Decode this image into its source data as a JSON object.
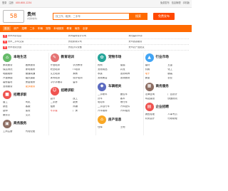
{
  "topbar": {
    "left": [
      "登录",
      "注册"
    ],
    "phone": "400-600-1234",
    "right": [
      "免费发布",
      "信息管理",
      "手机版"
    ]
  },
  "header": {
    "logo": "58",
    "city": "贵州",
    "switch": "[切换城市]",
    "search_placeholder": "找工作、租房、二手车",
    "search_button": "搜索",
    "post_button": "免费发布"
  },
  "nav": [
    "首页",
    "房产",
    "招聘",
    "二手",
    "车辆",
    "宠物",
    "本地服务",
    "教育",
    "商务",
    "全部"
  ],
  "ads": [
    [
      "贵州商务信息",
      "贵州装修设计公司",
      "贵阳建材市场"
    ],
    [
      "贵州二手车交易",
      "贵阳家政公司",
      "贵州旅游服务"
    ],
    [
      "贵州物流货运",
      "贵阳办公设备",
      "贵州农产品批发"
    ]
  ],
  "sections": {
    "local": {
      "title": "本地生活",
      "items": [
        "家政服务",
        "搬家服务",
        "保洁清洗",
        "家电维修",
        "电脑维修",
        "管道疏通",
        "开锁换锁",
        "婚庆摄影",
        "装修建材",
        "房屋维修",
        "宠物服务",
        "更多服务"
      ]
    },
    "edu": {
      "title": "教育培训",
      "items": [
        "外语培训",
        "学历教育",
        "职业培训",
        "IT培训",
        "文艺培训",
        "家教",
        "体育培训",
        "设计培训",
        "中小学辅导",
        "留学"
      ]
    },
    "recruit": {
      "title": "招聘求职",
      "items": [
        "普工",
        "司机",
        "销售",
        "客服",
        "厨师",
        "保安",
        "服务员",
        "文员",
        "会计",
        "技工"
      ]
    },
    "pet": {
      "title": "宠物市场",
      "items": [
        "狗狗",
        "猫猫",
        "宠物用品",
        "异宠",
        "水族",
        "宠物寄养",
        "宠物美容",
        "宠物医院"
      ]
    },
    "car": {
      "title": "车辆相关",
      "items": [
        "二手轿车",
        "面包车",
        "货车",
        "客车",
        "电动车",
        "摩托车",
        "二手自行车",
        "汽车配件",
        "汽车维修",
        "汽车租赁"
      ]
    },
    "house": {
      "title": "房产信息",
      "items": [
        "二手房",
        "新房",
        "租房",
        "商铺",
        "写字楼",
        "厂房",
        "仓库",
        "土地"
      ]
    },
    "business": {
      "title": "商务服务",
      "items": [
        "工商注册",
        "代理记账",
        "法律咨询",
        "广告设计",
        "网站建设",
        "快递物流"
      ]
    },
    "industry": {
      "title": "行业市场",
      "items": [
        "建材",
        "五金",
        "机械",
        "化工",
        "电子",
        "服装",
        "食品",
        "农业"
      ]
    },
    "corp": {
      "title": "企业招聘",
      "items": [
        "销售经理",
        "人事专员",
        "财务会计",
        "行政助理"
      ]
    }
  },
  "colors": {
    "accent": "#ff6a00",
    "edu": "#e57373",
    "recruit": "#ef5350",
    "pet": "#26a69a",
    "car": "#5c6bc0",
    "house": "#f9a825",
    "business": "#8d6e63",
    "industry": "#42a5f5",
    "local": "#66bb6a"
  }
}
